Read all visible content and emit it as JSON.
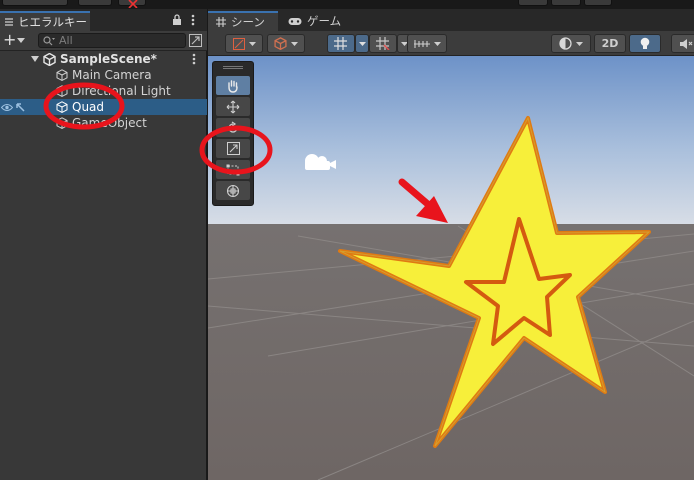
{
  "hierarchy": {
    "tab_label": "ヒエラルキー",
    "search_placeholder": "All",
    "add_label": "+",
    "scene_name": "SampleScene*",
    "items": [
      {
        "label": "Main Camera"
      },
      {
        "label": "Directional Light"
      },
      {
        "label": "Quad"
      },
      {
        "label": "GameObject"
      }
    ]
  },
  "scene_view": {
    "tabs": [
      {
        "label": "シーン"
      },
      {
        "label": "ゲーム"
      }
    ],
    "toolbar": {
      "mode_2d_label": "2D"
    }
  },
  "colors": {
    "annotation_red": "#e8141c",
    "selection_blue": "#2c5d87",
    "star_fill": "#f7ef3a",
    "star_outline": "#e07a12"
  }
}
